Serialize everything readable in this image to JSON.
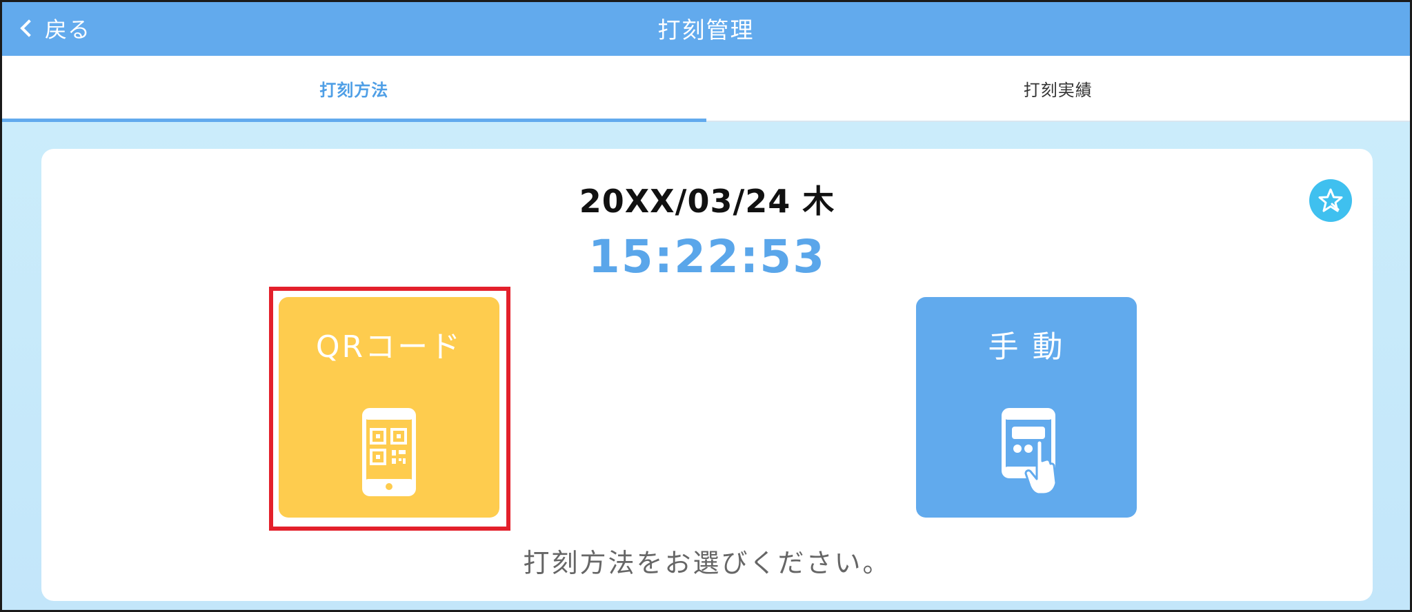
{
  "header": {
    "back_label": "戻る",
    "title": "打刻管理"
  },
  "tabs": [
    {
      "label": "打刻方法",
      "active": true
    },
    {
      "label": "打刻実績",
      "active": false
    }
  ],
  "main": {
    "date": "20XX/03/24 木",
    "time": "15:22:53",
    "methods": [
      {
        "label": "QRコード",
        "icon": "phone-qr-icon",
        "color": "#fecc4e",
        "highlighted": true
      },
      {
        "label": "手 動",
        "icon": "tablet-touch-icon",
        "color": "#61aaed",
        "highlighted": false
      }
    ],
    "prompt": "打刻方法をお選びください。",
    "star_icon": "star-icon"
  },
  "colors": {
    "header": "#62aaed",
    "accent": "#5aa6ea",
    "highlight_border": "#e3202b",
    "background": "#c8ebfb"
  }
}
